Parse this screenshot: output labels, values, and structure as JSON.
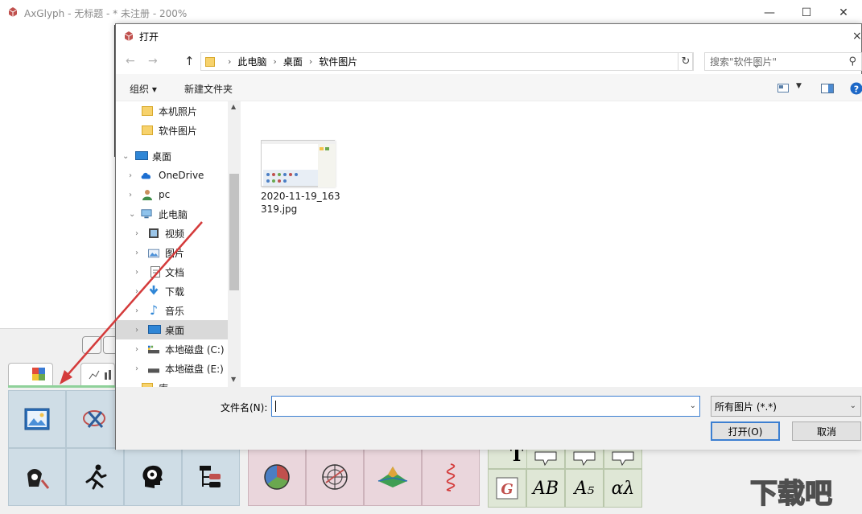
{
  "app": {
    "title": "AxGlyph - 无标题 - * 未注册 - 200%",
    "window_buttons": {
      "minimize": "—",
      "maximize": "☐",
      "close": "✕"
    },
    "watermark": "下载吧"
  },
  "dialog": {
    "title": "打开",
    "close": "×",
    "nav": {
      "back": "←",
      "forward": "→",
      "up": "↑"
    },
    "breadcrumb": [
      "此电脑",
      "桌面",
      "软件图片"
    ],
    "search_placeholder": "搜索\"软件图片\"",
    "toolbar": {
      "organize": "组织 ▾",
      "new_folder": "新建文件夹"
    },
    "nav_items": [
      {
        "label": "本机照片",
        "icon": "folder-icon"
      },
      {
        "label": "软件图片",
        "icon": "folder-icon"
      },
      {
        "label": "桌面",
        "icon": "desktop-icon"
      },
      {
        "label": "OneDrive",
        "icon": "cloud-icon"
      },
      {
        "label": "pc",
        "icon": "user-icon"
      },
      {
        "label": "此电脑",
        "icon": "computer-icon"
      },
      {
        "label": "视频",
        "icon": "video-icon"
      },
      {
        "label": "图片",
        "icon": "image-icon"
      },
      {
        "label": "文档",
        "icon": "document-icon"
      },
      {
        "label": "下载",
        "icon": "download-icon"
      },
      {
        "label": "音乐",
        "icon": "music-icon"
      },
      {
        "label": "桌面",
        "icon": "desktop-icon"
      },
      {
        "label": "本地磁盘 (C:)",
        "icon": "drive-icon"
      },
      {
        "label": "本地磁盘 (E:)",
        "icon": "drive-icon"
      },
      {
        "label": "库",
        "icon": "library-icon"
      }
    ],
    "selected_nav_item": "桌面",
    "file": {
      "name": "2020-11-19_163319.jpg"
    },
    "filename_label": "文件名(N):",
    "filename_value": "",
    "file_type": "所有图片 (*.*)",
    "open_button": "打开(O)",
    "cancel_button": "取消"
  },
  "toolbox": {
    "green_tiles_text": [
      "T",
      "AB",
      "A₅",
      "αλ"
    ]
  }
}
